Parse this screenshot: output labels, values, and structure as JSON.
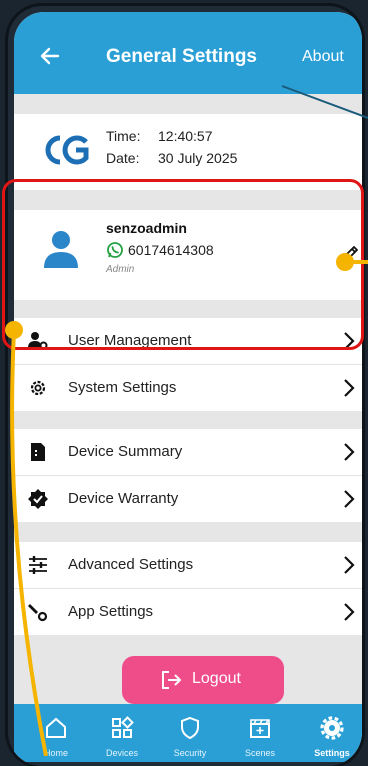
{
  "header": {
    "title": "General Settings",
    "about_label": "About"
  },
  "time_card": {
    "time_label": "Time:",
    "time_value": "12:40:57",
    "date_label": "Date:",
    "date_value": "30 July 2025"
  },
  "profile": {
    "username": "senzoadmin",
    "phone": "60174614308",
    "role": "Admin"
  },
  "menu": {
    "user_management": "User Management",
    "system_settings": "System Settings",
    "device_summary": "Device Summary",
    "device_warranty": "Device Warranty",
    "advanced_settings": "Advanced Settings",
    "app_settings": "App Settings"
  },
  "logout_label": "Logout",
  "nav": {
    "home": "Home",
    "devices": "Devices",
    "security": "Security",
    "scenes": "Scenes",
    "settings": "Settings"
  },
  "colors": {
    "header_blue": "#2a9fd6",
    "logout_pink": "#ee4d8a",
    "annotation_red": "#e01515",
    "annotation_yellow": "#f5b400",
    "whatsapp_green": "#25a244"
  }
}
